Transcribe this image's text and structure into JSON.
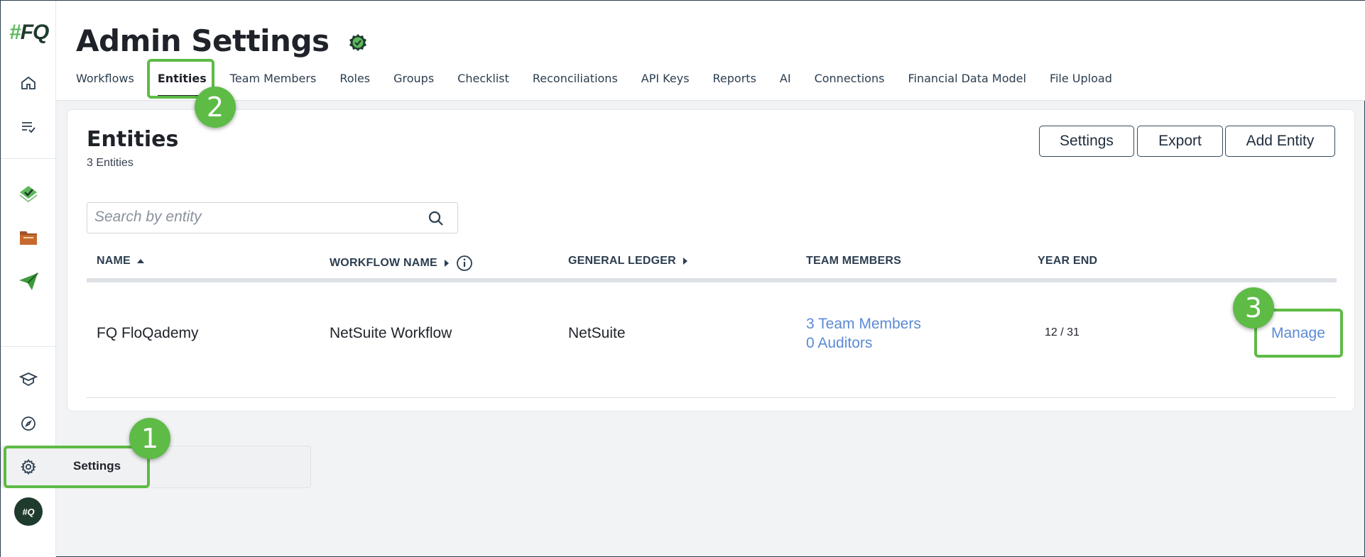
{
  "app": {
    "logo_hash": "#",
    "logo_text": "FQ",
    "avatar_text": "#Q"
  },
  "sidebar": {
    "items": [
      {
        "name": "home-icon"
      },
      {
        "name": "tasks-icon"
      },
      {
        "name": "checklist-icon"
      },
      {
        "name": "folder-icon"
      },
      {
        "name": "send-icon"
      },
      {
        "name": "academy-icon"
      },
      {
        "name": "compass-icon"
      },
      {
        "name": "gear-icon"
      }
    ],
    "settings_label": "Settings"
  },
  "header": {
    "title": "Admin Settings",
    "tabs": [
      {
        "label": "Workflows"
      },
      {
        "label": "Entities"
      },
      {
        "label": "Team Members"
      },
      {
        "label": "Roles"
      },
      {
        "label": "Groups"
      },
      {
        "label": "Checklist"
      },
      {
        "label": "Reconciliations"
      },
      {
        "label": "API Keys"
      },
      {
        "label": "Reports"
      },
      {
        "label": "AI"
      },
      {
        "label": "Connections"
      },
      {
        "label": "Financial Data Model"
      },
      {
        "label": "File Upload"
      }
    ],
    "active_tab": "Entities"
  },
  "entities": {
    "title": "Entities",
    "count_label": "3 Entities",
    "buttons": {
      "settings": "Settings",
      "export": "Export",
      "add": "Add Entity"
    },
    "search": {
      "placeholder": "Search by entity",
      "value": ""
    },
    "columns": {
      "name": "NAME",
      "workflow": "WORKFLOW NAME",
      "ledger": "GENERAL LEDGER",
      "team": "TEAM MEMBERS",
      "year_end": "YEAR END"
    },
    "rows": [
      {
        "name": "FQ FloQademy",
        "workflow": "NetSuite Workflow",
        "ledger": "NetSuite",
        "team_members": "3 Team Members",
        "auditors": "0 Auditors",
        "year_end": "12 / 31",
        "action": "Manage"
      }
    ]
  },
  "annotations": {
    "step1": "1",
    "step2": "2",
    "step3": "3"
  },
  "colors": {
    "accent_green": "#5dbb46",
    "link_blue": "#5b8ad6",
    "brand_dark": "#1f3b2d"
  }
}
